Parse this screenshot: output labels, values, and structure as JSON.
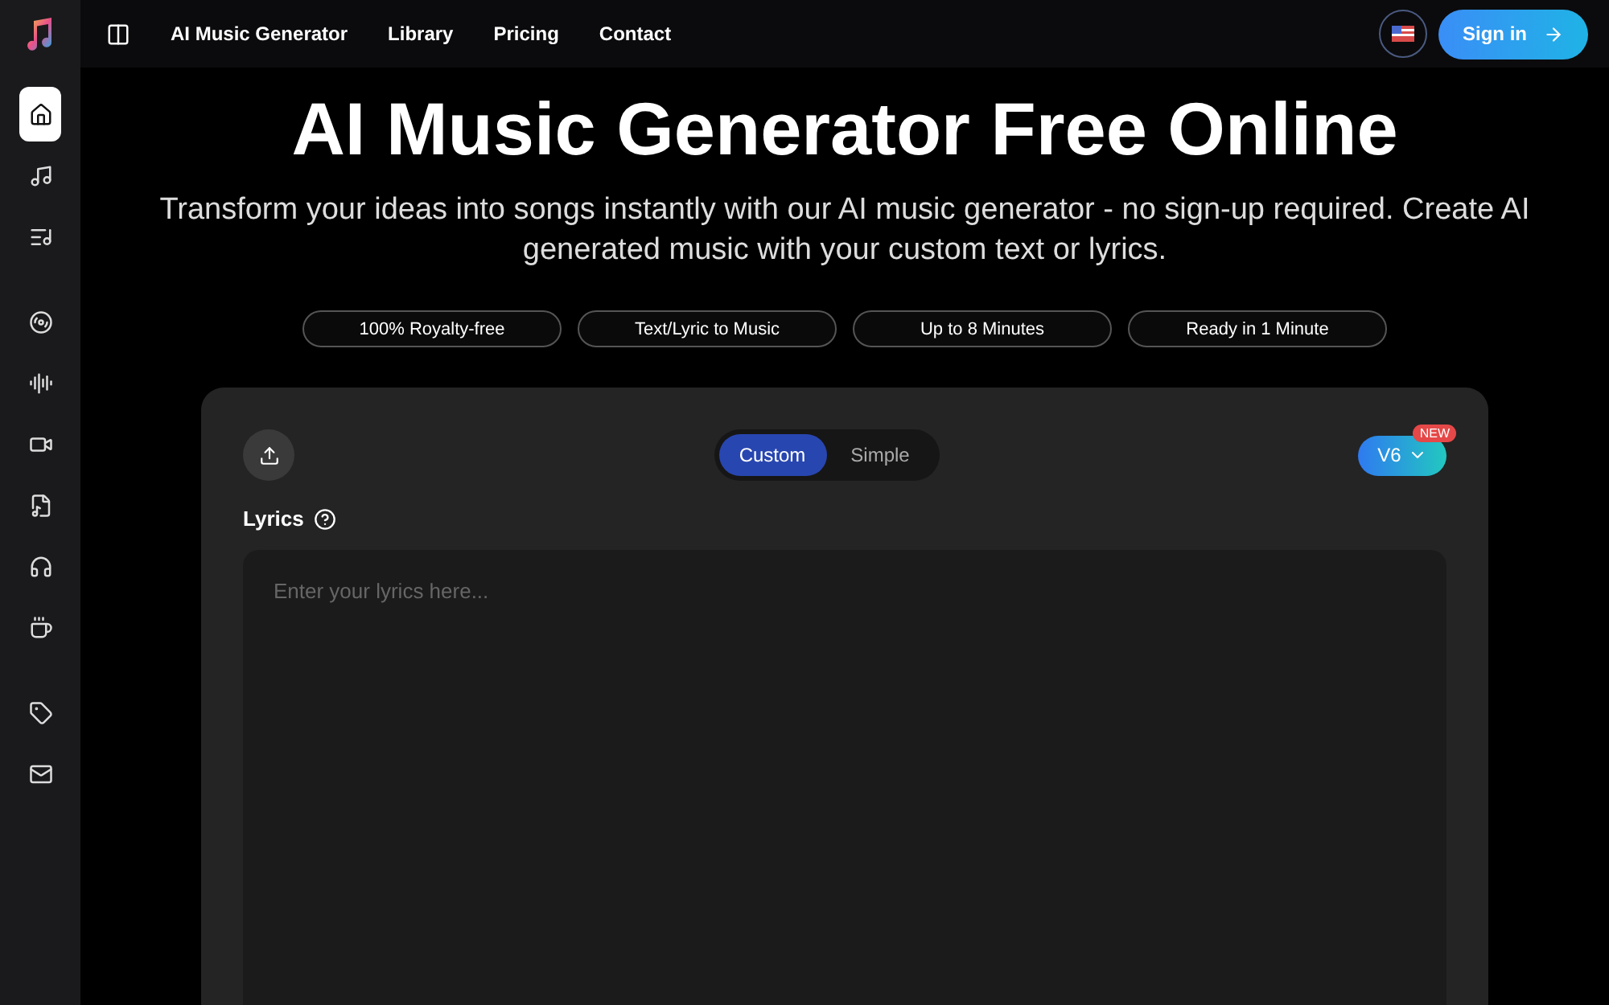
{
  "header": {
    "nav": [
      {
        "label": "AI Music Generator"
      },
      {
        "label": "Library"
      },
      {
        "label": "Pricing"
      },
      {
        "label": "Contact"
      }
    ],
    "sign_in": "Sign in"
  },
  "sidebar": {
    "items": [
      {
        "selected": true
      },
      {
        "selected": false
      },
      {
        "selected": false
      },
      {
        "selected": false
      },
      {
        "selected": false
      },
      {
        "selected": false
      },
      {
        "selected": false
      },
      {
        "selected": false
      },
      {
        "selected": false
      },
      {
        "selected": false
      },
      {
        "selected": false
      }
    ]
  },
  "hero": {
    "title": "AI Music Generator Free Online",
    "subtitle": "Transform your ideas into songs instantly with our AI music generator - no sign-up required. Create AI generated music with your custom text or lyrics.",
    "features": [
      "100% Royalty-free",
      "Text/Lyric to Music",
      "Up to 8 Minutes",
      "Ready in 1 Minute"
    ]
  },
  "generator": {
    "modes": [
      {
        "label": "Custom",
        "selected": true
      },
      {
        "label": "Simple",
        "selected": false
      }
    ],
    "version": "V6",
    "version_badge": "NEW",
    "lyrics_label": "Lyrics",
    "lyrics": {
      "placeholder": "Enter your lyrics here..."
    }
  }
}
